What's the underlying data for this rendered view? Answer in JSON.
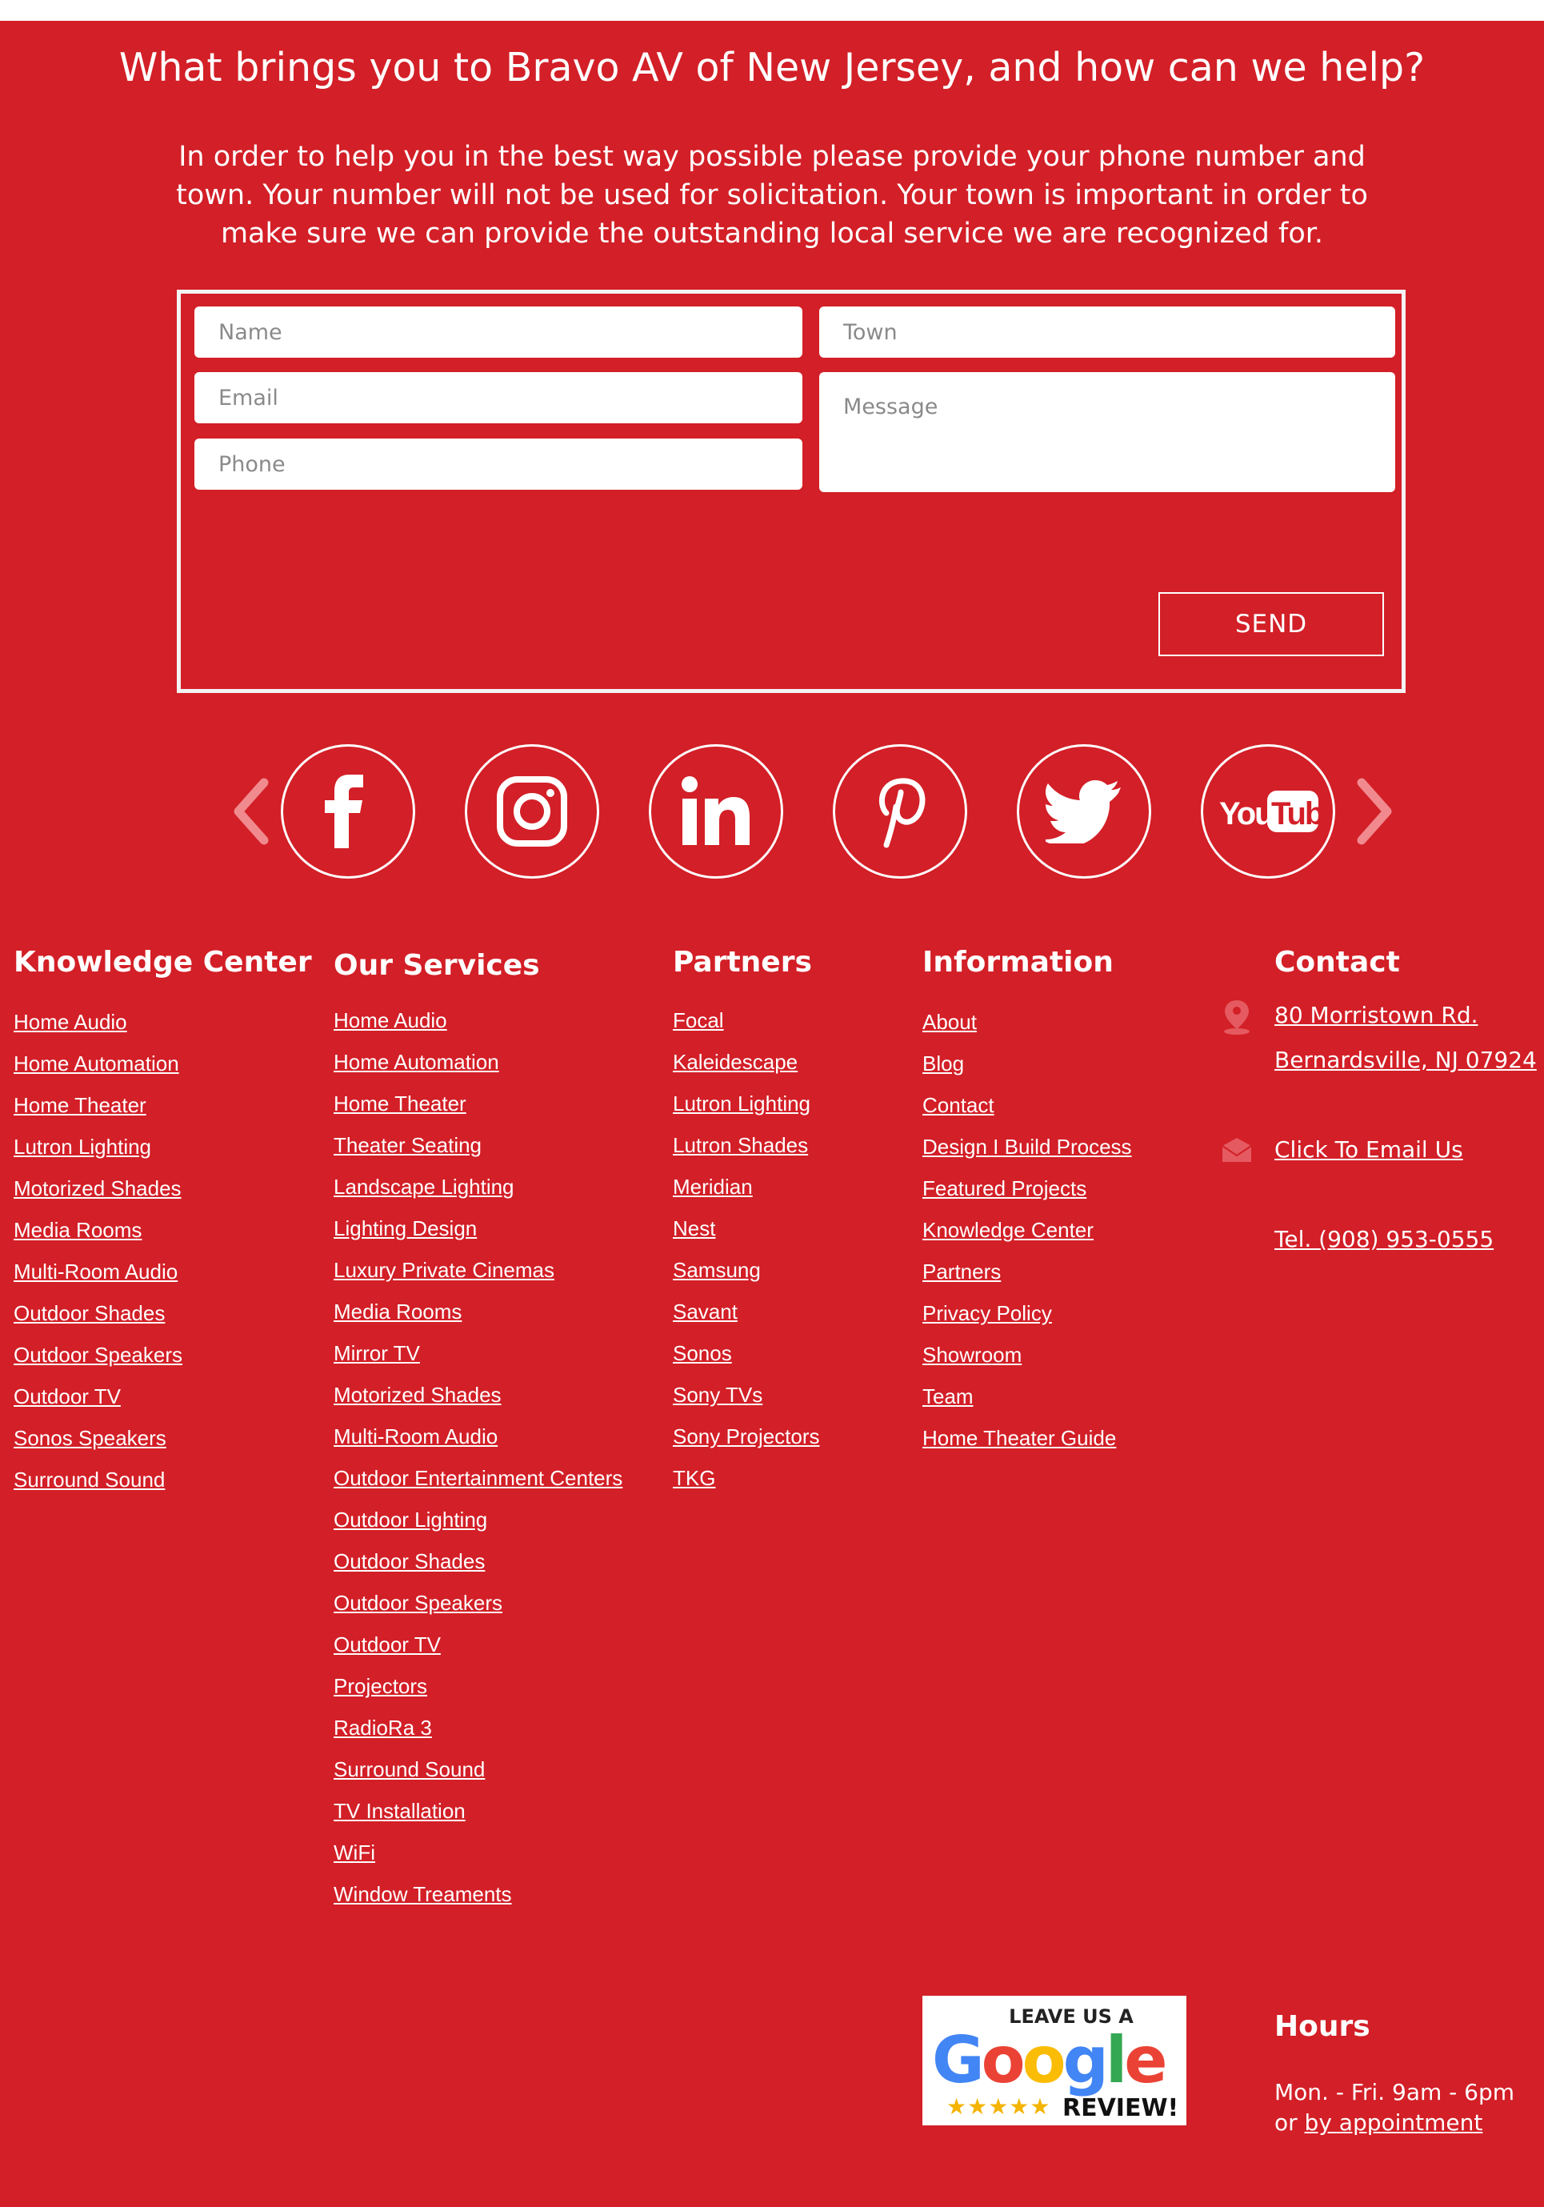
{
  "contact_form": {
    "heading": "What brings you to Bravo AV of New Jersey, and how can we help?",
    "intro": "In order to help you in the best way possible please provide your phone number and town. Your number will not be used for solicitation. Your town is important in order to make sure we can provide the outstanding local service we are recognized for.",
    "name_placeholder": "Name",
    "email_placeholder": "Email",
    "phone_placeholder": "Phone",
    "town_placeholder": "Town",
    "message_placeholder": "Message",
    "send_label": "SEND"
  },
  "social": {
    "icons": [
      "facebook-icon",
      "instagram-icon",
      "linkedin-icon",
      "pinterest-icon",
      "twitter-icon",
      "youtube-icon"
    ],
    "youtube_text": "YouTube"
  },
  "footer": {
    "knowledge_center": {
      "title": "Knowledge Center",
      "links": [
        "Home Audio",
        "Home Automation",
        "Home Theater",
        "Lutron Lighting",
        "Motorized Shades",
        "Media Rooms",
        "Multi-Room Audio",
        "Outdoor Shades",
        "Outdoor Speakers",
        "Outdoor TV",
        "Sonos Speakers",
        "Surround Sound"
      ]
    },
    "our_services": {
      "title": "Our Services",
      "links": [
        "Home Audio",
        "Home Automation",
        "Home Theater",
        "Theater Seating",
        "Landscape Lighting",
        "Lighting Design",
        "Luxury Private Cinemas",
        "Media Rooms",
        "Mirror TV",
        "Motorized Shades",
        "Multi-Room Audio",
        "Outdoor Entertainment Centers",
        "Outdoor Lighting",
        "Outdoor Shades",
        "Outdoor Speakers",
        "Outdoor TV",
        "Projectors",
        "RadioRa 3",
        "Surround Sound",
        "TV Installation",
        "WiFi ",
        "Window Treaments"
      ]
    },
    "partners": {
      "title": "Partners",
      "links": [
        "Focal ",
        "Kaleidescape",
        "Lutron Lighting",
        "Lutron Shades",
        "Meridian",
        "Nest",
        "Samsung",
        "Savant ",
        "Sonos",
        "Sony TVs",
        "Sony Projectors",
        "TKG"
      ]
    },
    "information": {
      "title": "Information",
      "links": [
        "About ",
        "Blog",
        "Contact",
        "Design I Build Process",
        "Featured Projects",
        "Knowledge Center",
        "Partners",
        "Privacy Policy ",
        "Showroom",
        "Team",
        "Home Theater Guide"
      ]
    },
    "contact": {
      "title": "Contact",
      "address_line1": "80 Morristown Rd.",
      "address_line2": "Bernardsville, NJ 07924",
      "email_link": "Click To Email Us",
      "phone_link": "Tel. (908) 953-0555"
    },
    "google_badge": {
      "top": "LEAVE US A",
      "word": "Google",
      "bottom": "REVIEW!",
      "stars": "★★★★★"
    },
    "hours": {
      "title": "Hours",
      "line1": "Mon. - Fri. 9am - 6pm",
      "line2_prefix": "or ",
      "line2_link": "by appointment"
    }
  },
  "colors": {
    "background": "#d31f27",
    "text": "#ffffff",
    "input_bg": "#ffffff",
    "placeholder": "#8a8a8a"
  }
}
